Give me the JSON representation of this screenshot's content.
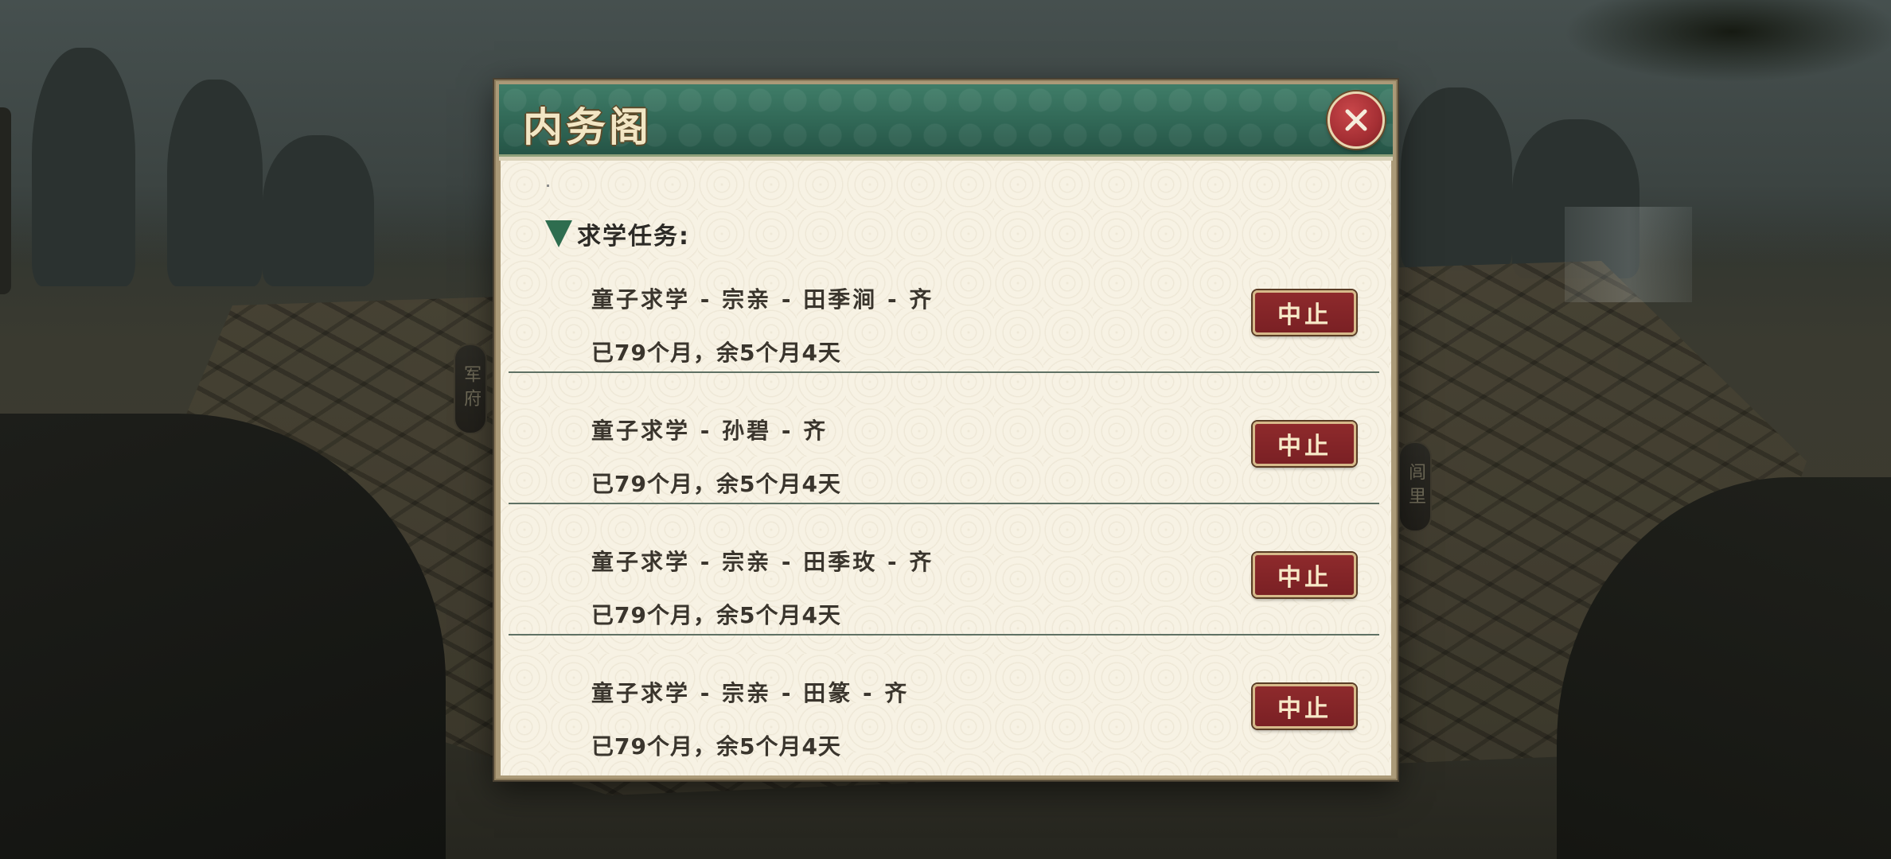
{
  "background": {
    "side_tags": [
      "军府",
      "闾里"
    ]
  },
  "dialog": {
    "title": "内务阁",
    "close_icon": "close-icon",
    "section_label": "求学任务:",
    "stop_label": "中止",
    "tasks": [
      {
        "title": "童子求学 - 宗亲 - 田季涧 - 齐",
        "progress": "已79个月，余5个月4天"
      },
      {
        "title": "童子求学 - 孙碧 - 齐",
        "progress": "已79个月，余5个月4天"
      },
      {
        "title": "童子求学 - 宗亲 - 田季玫 - 齐",
        "progress": "已79个月，余5个月4天"
      },
      {
        "title": "童子求学 - 宗亲 - 田篆 - 齐",
        "progress": "已79个月，余5个月4天"
      }
    ]
  },
  "colors": {
    "header_green": "#2f6554",
    "stop_button_red": "#7a2024",
    "close_button_red": "#a52f34",
    "panel_cream": "#f7f2e4",
    "triangle_green": "#2e6d4f"
  }
}
